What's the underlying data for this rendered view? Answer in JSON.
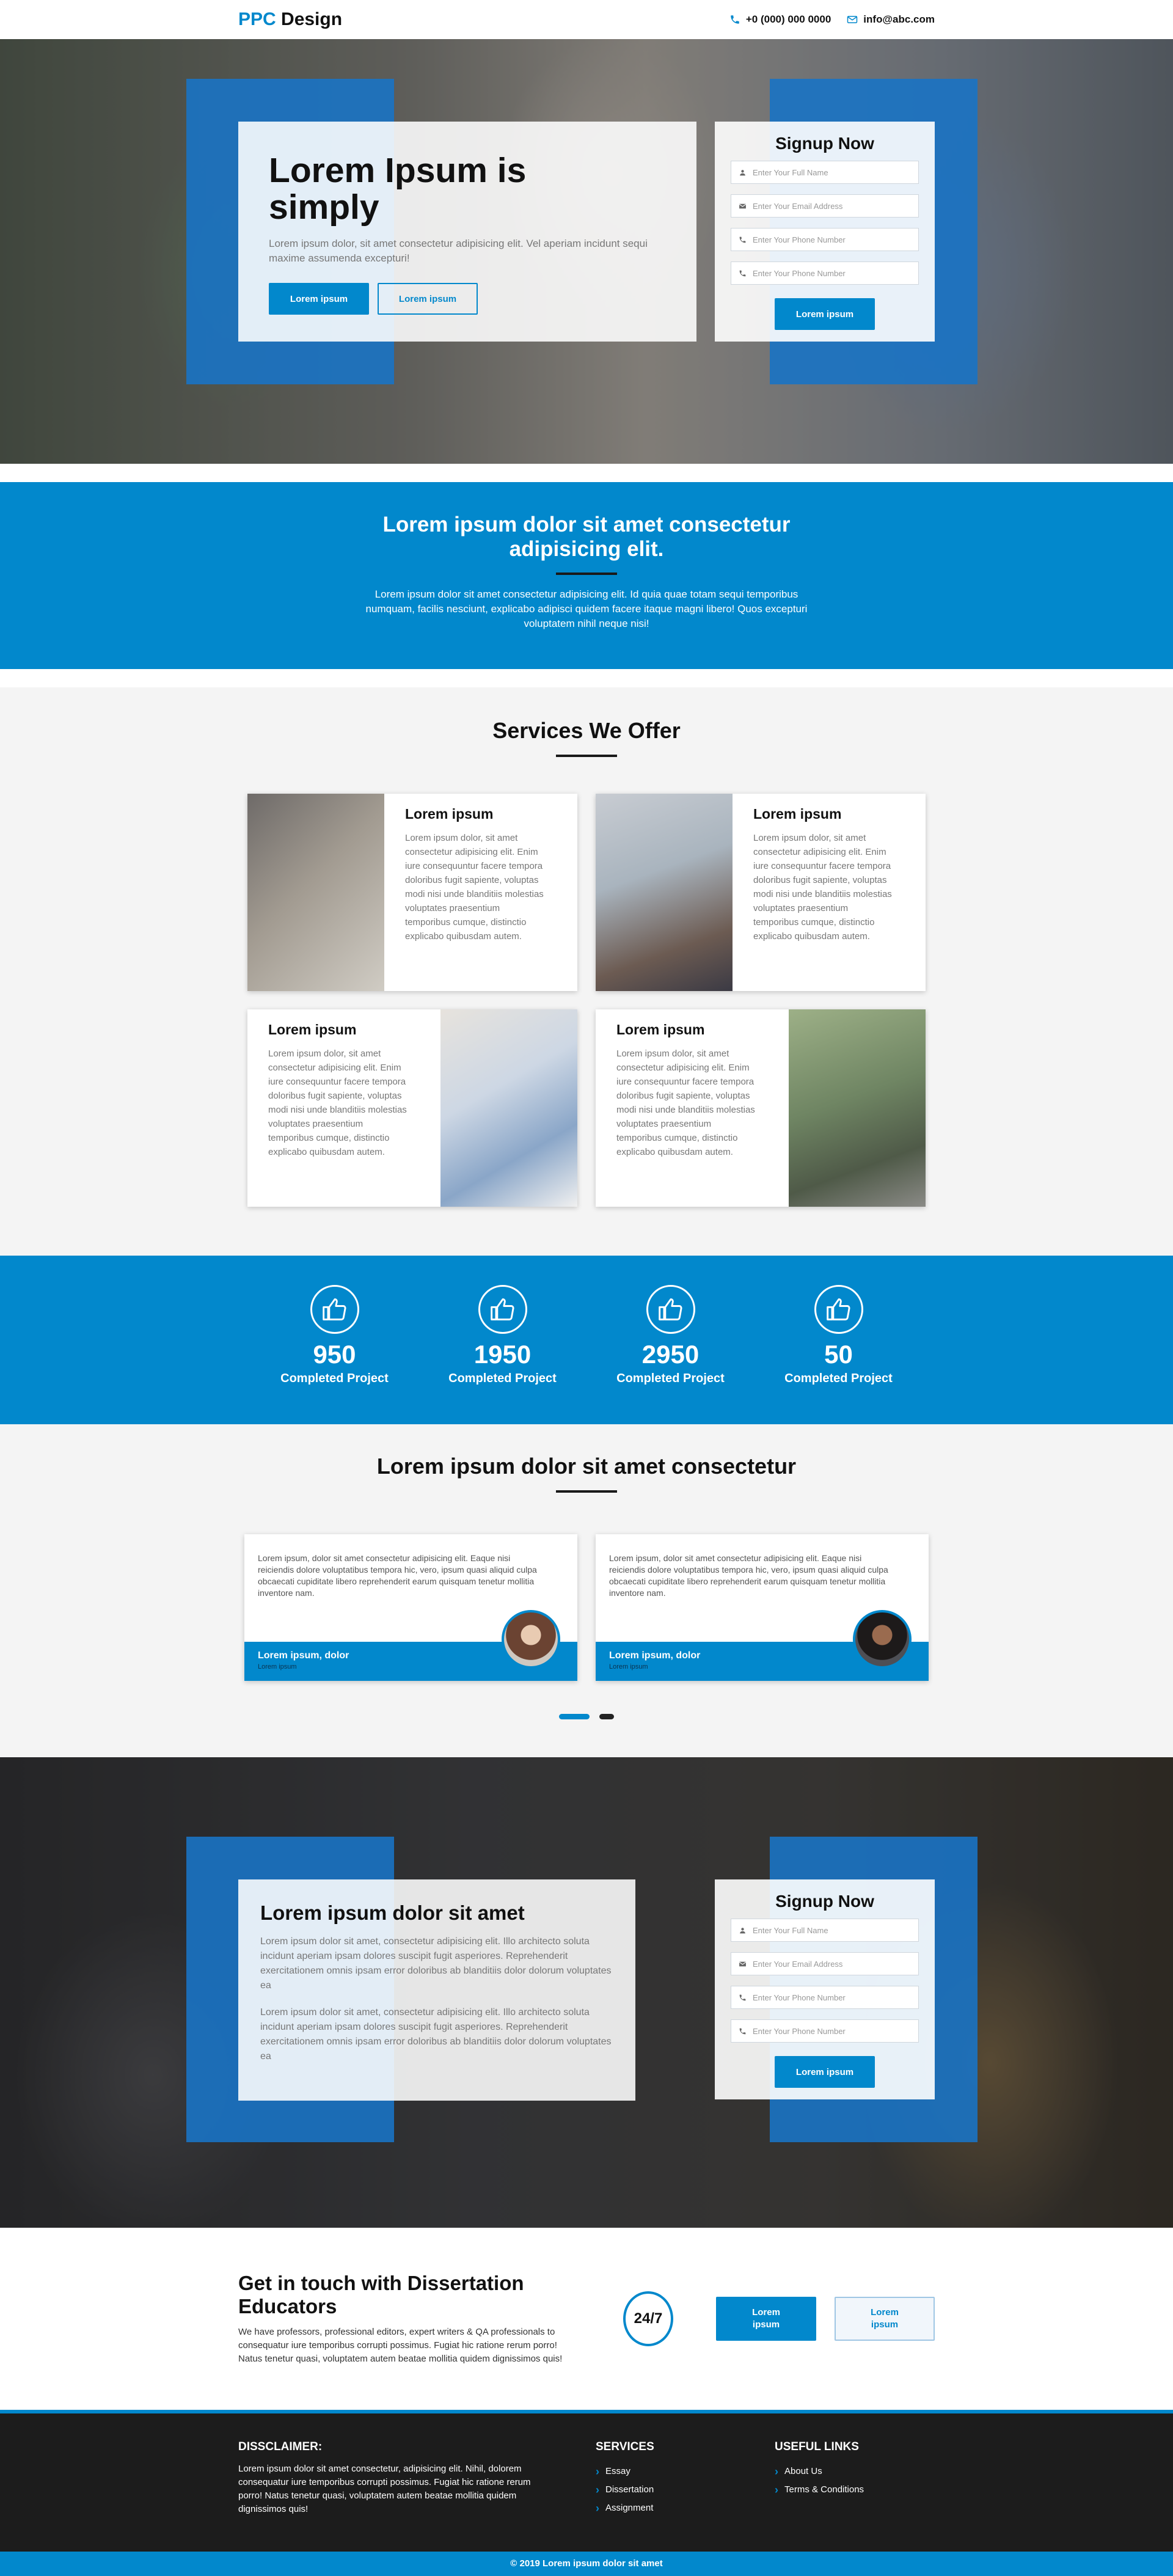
{
  "header": {
    "logo_accent": "PPC",
    "logo_rest": " Design",
    "phone": "+0 (000) 000 0000",
    "email": "info@abc.com"
  },
  "hero": {
    "title": "Lorem Ipsum is simply",
    "text": "Lorem ipsum dolor, sit amet consectetur adipisicing elit. Vel aperiam incidunt sequi maxime assumenda excepturi!",
    "btn_primary": "Lorem ipsum",
    "btn_secondary": "Lorem ipsum"
  },
  "signup": {
    "title": "Signup Now",
    "name_placeholder": "Enter Your Full Name",
    "email_placeholder": "Enter Your Email Address",
    "phone_placeholder": "Enter Your Phone Number",
    "phone2_placeholder": "Enter Your Phone Number",
    "submit": "Lorem ipsum"
  },
  "intro": {
    "title": "Lorem ipsum dolor sit amet consectetur adipisicing elit.",
    "text": "Lorem ipsum dolor sit amet consectetur adipisicing elit. Id quia quae totam sequi temporibus numquam, facilis nesciunt, explicabo adipisci quidem facere itaque magni libero! Quos excepturi voluptatem nihil neque nisi!"
  },
  "services": {
    "title": "Services We Offer",
    "items": [
      {
        "title": "Lorem ipsum",
        "text": "Lorem ipsum dolor, sit amet consectetur adipisicing elit. Enim iure consequuntur facere tempora doloribus fugit sapiente, voluptas modi nisi unde blanditiis molestias voluptates praesentium temporibus cumque, distinctio explicabo quibusdam autem."
      },
      {
        "title": "Lorem ipsum",
        "text": "Lorem ipsum dolor, sit amet consectetur adipisicing elit. Enim iure consequuntur facere tempora doloribus fugit sapiente, voluptas modi nisi unde blanditiis molestias voluptates praesentium temporibus cumque, distinctio explicabo quibusdam autem."
      },
      {
        "title": "Lorem ipsum",
        "text": "Lorem ipsum dolor, sit amet consectetur adipisicing elit. Enim iure consequuntur facere tempora doloribus fugit sapiente, voluptas modi nisi unde blanditiis molestias voluptates praesentium temporibus cumque, distinctio explicabo quibusdam autem."
      },
      {
        "title": "Lorem ipsum",
        "text": "Lorem ipsum dolor, sit amet consectetur adipisicing elit. Enim iure consequuntur facere tempora doloribus fugit sapiente, voluptas modi nisi unde blanditiis molestias voluptates praesentium temporibus cumque, distinctio explicabo quibusdam autem."
      }
    ]
  },
  "stats": [
    {
      "value": "950",
      "label": "Completed Project",
      "icon": "thumbs-up-icon"
    },
    {
      "value": "1950",
      "label": "Completed Project",
      "icon": "thumbs-up-icon"
    },
    {
      "value": "2950",
      "label": "Completed Project",
      "icon": "thumbs-up-icon"
    },
    {
      "value": "50",
      "label": "Completed Project",
      "icon": "thumbs-up-icon"
    }
  ],
  "testimonials": {
    "title": "Lorem ipsum dolor sit amet consectetur",
    "items": [
      {
        "text": "Lorem ipsum, dolor sit amet consectetur adipisicing elit. Eaque nisi reiciendis dolore voluptatibus tempora hic, vero, ipsum quasi aliquid culpa obcaecati cupiditate libero reprehenderit earum quisquam tenetur mollitia inventore nam.",
        "name": "Lorem ipsum, dolor",
        "role": "Lorem ipsum"
      },
      {
        "text": "Lorem ipsum, dolor sit amet consectetur adipisicing elit. Eaque nisi reiciendis dolore voluptatibus tempora hic, vero, ipsum quasi aliquid culpa obcaecati cupiditate libero reprehenderit earum quisquam tenetur mollitia inventore nam.",
        "name": "Lorem ipsum, dolor",
        "role": "Lorem ipsum"
      }
    ]
  },
  "about": {
    "title": "Lorem ipsum dolor sit amet",
    "p1": "Lorem ipsum dolor sit amet, consectetur adipisicing elit. Illo architecto soluta incidunt aperiam ipsam dolores suscipit fugit asperiores. Reprehenderit exercitationem omnis ipsam error doloribus ab blanditiis dolor dolorum voluptates ea",
    "p2": "Lorem ipsum dolor sit amet, consectetur adipisicing elit. Illo architecto soluta incidunt aperiam ipsam dolores suscipit fugit asperiores. Reprehenderit exercitationem omnis ipsam error doloribus ab blanditiis dolor dolorum voluptates ea"
  },
  "contact": {
    "title": "Get in touch with Dissertation Educators",
    "text": "We have professors, professional editors, expert writers & QA professionals to consequatur iure temporibus corrupti possimus. Fugiat hic ratione rerum porro! Natus tenetur quasi, voluptatem autem beatae mollitia quidem dignissimos quis!",
    "clock": "24/7",
    "btn_primary": "Lorem ipsum",
    "btn_secondary": "Lorem ipsum"
  },
  "footer": {
    "disclaimer_title": "DISSCLAIMER:",
    "disclaimer_text": "Lorem ipsum dolor sit amet consectetur, adipisicing elit. Nihil, dolorem consequatur iure temporibus corrupti possimus. Fugiat hic ratione rerum porro! Natus tenetur quasi, voluptatem autem beatae mollitia quidem dignissimos quis!",
    "services_title": "SERVICES",
    "services": [
      "Essay",
      "Dissertation",
      "Assignment"
    ],
    "links_title": "USEFUL LINKS",
    "links": [
      "About Us",
      "Terms & Conditions"
    ],
    "copyright": "© 2019 Lorem ipsum dolor sit amet"
  },
  "colors": {
    "accent": "#0288cc",
    "footer_bg": "#1c1c1c"
  }
}
